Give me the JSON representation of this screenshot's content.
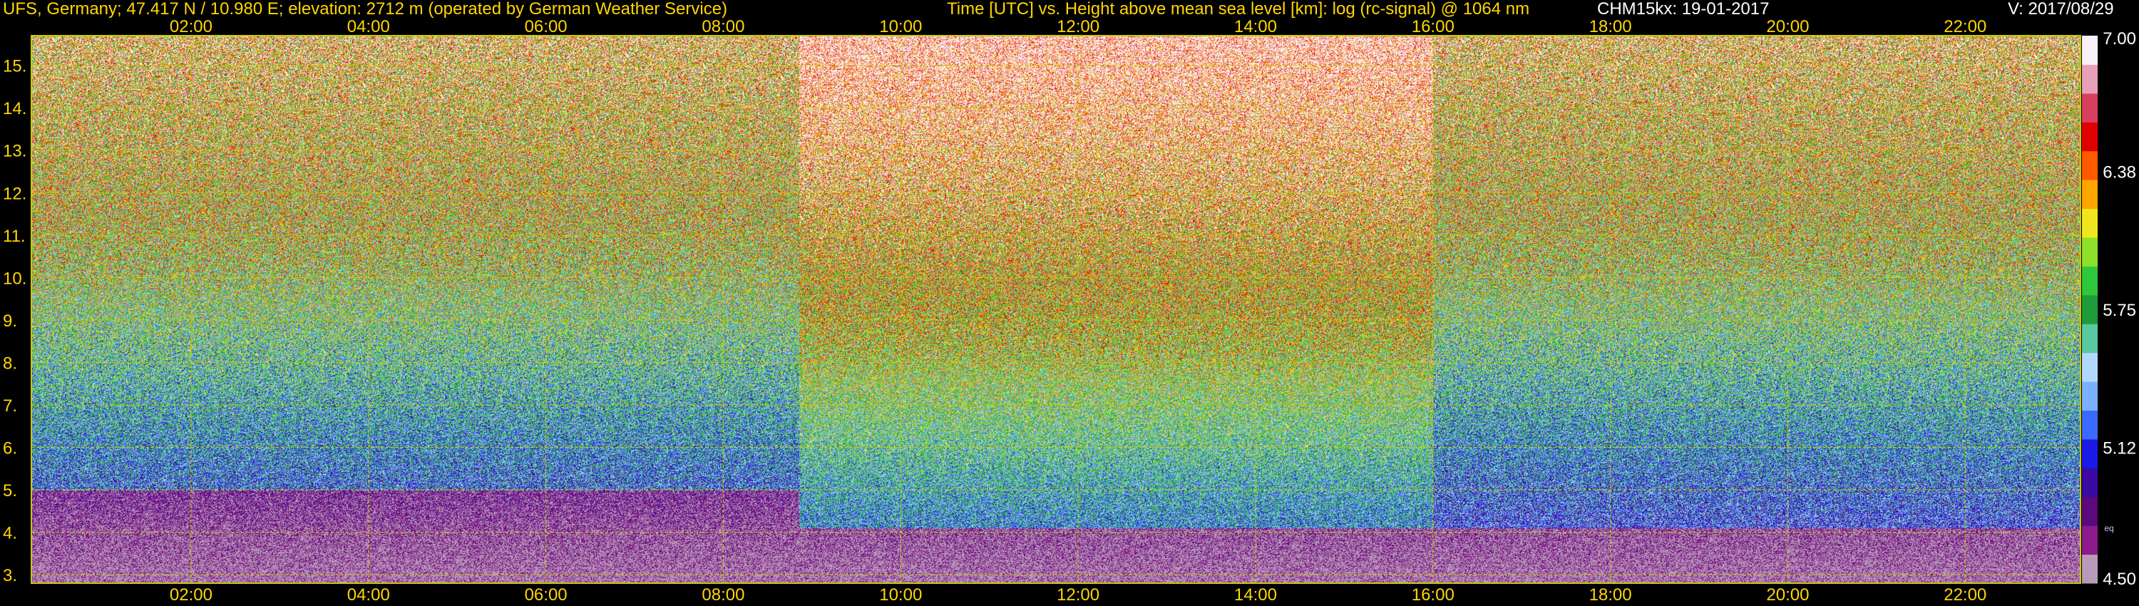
{
  "header": {
    "station": "UFS, Germany; 47.417 N / 10.980 E; elevation: 2712 m  (operated by German Weather Service)",
    "plot_title": "Time [UTC] vs. Height above mean sea level [km]: log (rc-signal) @ 1064 nm",
    "instrument_date": "CHM15kx: 19-01-2017",
    "version": "V: 2017/08/29"
  },
  "colors": {
    "header_left": "#ffd700",
    "header_mid": "#ffd700",
    "header_white": "#ffffff",
    "axis_text": "#ffd700",
    "grid": "#c8c800",
    "background": "#000000"
  },
  "chart_data": {
    "type": "heatmap",
    "title": "Time [UTC] vs. Height above mean sea level [km]: log (rc-signal) @ 1064 nm",
    "xlabel": "Time [UTC]",
    "ylabel": "Height above mean sea level [km]",
    "x_unit": "hour UTC",
    "xlim": [
      0.2,
      23.3
    ],
    "ylim": [
      2.8,
      15.7
    ],
    "x_ticks": [
      "02:00",
      "04:00",
      "06:00",
      "08:00",
      "10:00",
      "12:00",
      "14:00",
      "16:00",
      "18:00",
      "20:00",
      "22:00"
    ],
    "x_tick_values": [
      2,
      4,
      6,
      8,
      10,
      12,
      14,
      16,
      18,
      20,
      22
    ],
    "y_ticks": [
      "3.",
      "4.",
      "5.",
      "6.",
      "7.",
      "8.",
      "9.",
      "10.",
      "11.",
      "12.",
      "13.",
      "14.",
      "15."
    ],
    "y_tick_values": [
      3,
      4,
      5,
      6,
      7,
      8,
      9,
      10,
      11,
      12,
      13,
      14,
      15
    ],
    "grid": true,
    "colorbar": {
      "min": 4.5,
      "max": 7.0,
      "tick_labels": [
        "7.00",
        "6.38",
        "5.75",
        "5.12",
        "4.50"
      ],
      "tick_values": [
        7.0,
        6.38,
        5.75,
        5.12,
        4.5
      ],
      "unit_label": "eq",
      "colors": [
        "#b89ab8",
        "#8c1a8c",
        "#5a0a7a",
        "#3a0aa0",
        "#1a1ae6",
        "#3a6aff",
        "#7ab0ff",
        "#b0d8ff",
        "#5ac8a0",
        "#1e9b3a",
        "#2ec83a",
        "#8ce02a",
        "#f0e61e",
        "#ffa500",
        "#ff5a00",
        "#e00000",
        "#d84060",
        "#e8a0b8",
        "#f8f0f8"
      ]
    },
    "regimes": [
      {
        "x_start": 0.2,
        "x_end": 8.85,
        "low_layer_top_km": 5.0,
        "mid_value": 5.9,
        "upper_value": 6.25
      },
      {
        "x_start": 8.85,
        "x_end": 16.0,
        "low_layer_top_km": 4.1,
        "mid_value": 6.0,
        "upper_value": 6.7
      },
      {
        "x_start": 16.0,
        "x_end": 23.3,
        "low_layer_top_km": 4.1,
        "mid_value": 5.8,
        "upper_value": 6.25
      }
    ]
  }
}
